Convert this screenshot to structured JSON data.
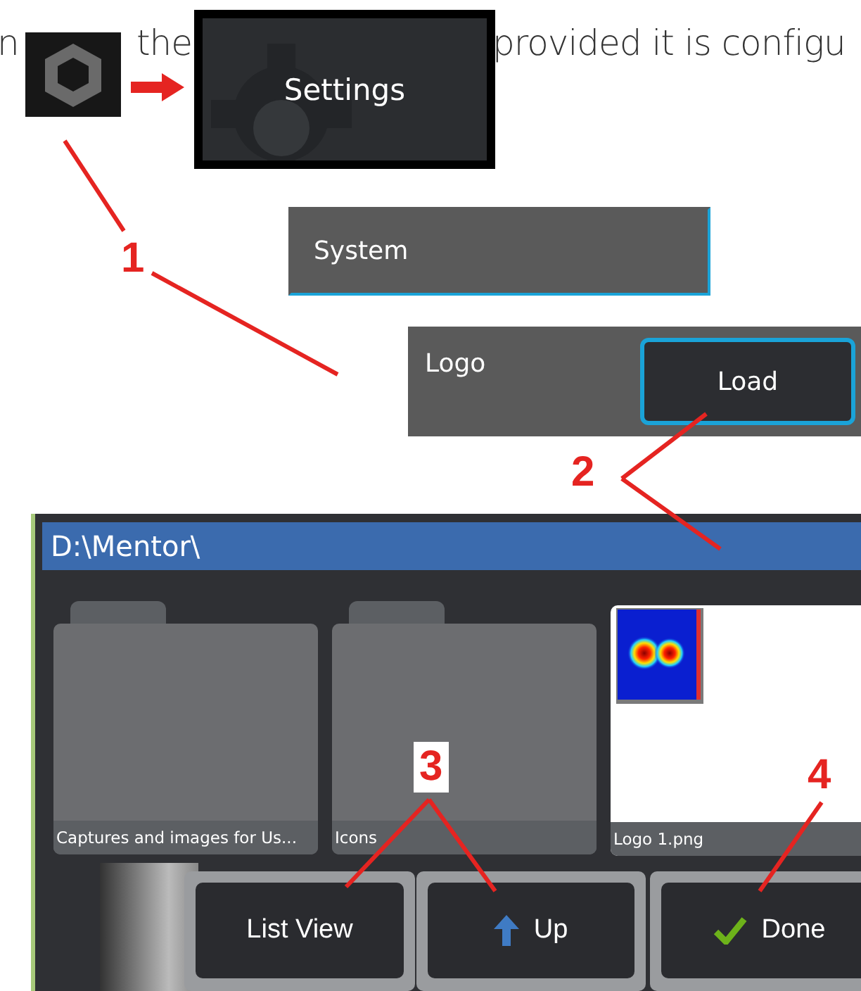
{
  "intro_text": [
    "n",
    "the",
    "provided it is configu"
  ],
  "settings_tile": {
    "label": "Settings"
  },
  "system_bar": {
    "label": "System"
  },
  "logo_row": {
    "label": "Logo",
    "button": "Load"
  },
  "file_browser": {
    "path": "D:\\Mentor\\",
    "items": [
      {
        "kind": "folder",
        "name": "Captures and images for Us..."
      },
      {
        "kind": "folder",
        "name": "Icons"
      },
      {
        "kind": "image",
        "name": "Logo 1.png"
      }
    ],
    "buttons": [
      {
        "kind": "plain",
        "label": "List View"
      },
      {
        "kind": "up",
        "label": "Up"
      },
      {
        "kind": "done",
        "label": "Done"
      }
    ]
  },
  "callouts": [
    "1",
    "2",
    "3",
    "4"
  ]
}
